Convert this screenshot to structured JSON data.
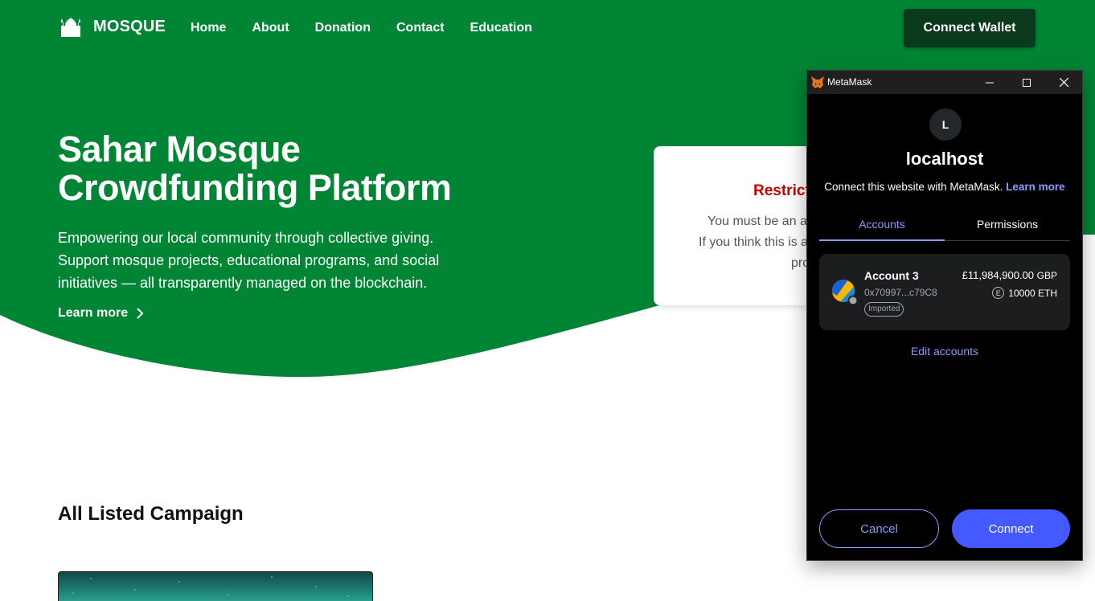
{
  "colors": {
    "brand_green": "#008535",
    "dark_green": "#0a3a1b",
    "restricted_red": "#cc0000",
    "metamask_accent": "#8b99ff",
    "metamask_primary": "#4459ff"
  },
  "navbar": {
    "logo_icon": "mosque-icon",
    "brand": "MOSQUE",
    "links": [
      "Home",
      "About",
      "Donation",
      "Contact",
      "Education"
    ],
    "connect_wallet": "Connect Wallet"
  },
  "hero": {
    "title_line1": "Sahar Mosque",
    "title_line2": "Crowdfunding Platform",
    "desc_line1": "Empowering our local community through collective giving.",
    "desc_line2": "Support mosque projects, educational programs, and social",
    "desc_line3": "initiatives — all transparently managed on the blockchain.",
    "learn_more": "Learn more"
  },
  "restricted": {
    "title": "Restrict",
    "line1": "You must be an a",
    "line2": "If you think this is a",
    "line3": "pro"
  },
  "campaigns": {
    "title": "All Listed Campaign"
  },
  "metamask": {
    "window_title": "MetaMask",
    "avatar_letter": "L",
    "host": "localhost",
    "connect_text": "Connect this website with MetaMask.",
    "learn_more": "Learn more",
    "tabs": [
      "Accounts",
      "Permissions"
    ],
    "account": {
      "name": "Account 3",
      "address": "0x70997...c79C8",
      "badge": "Imported",
      "fiat_amount": "£11,984,900.00",
      "fiat_currency": "GBP",
      "eth_icon": "E",
      "eth_amount": "10000 ETH"
    },
    "edit_accounts": "Edit accounts",
    "cancel": "Cancel",
    "connect": "Connect"
  }
}
